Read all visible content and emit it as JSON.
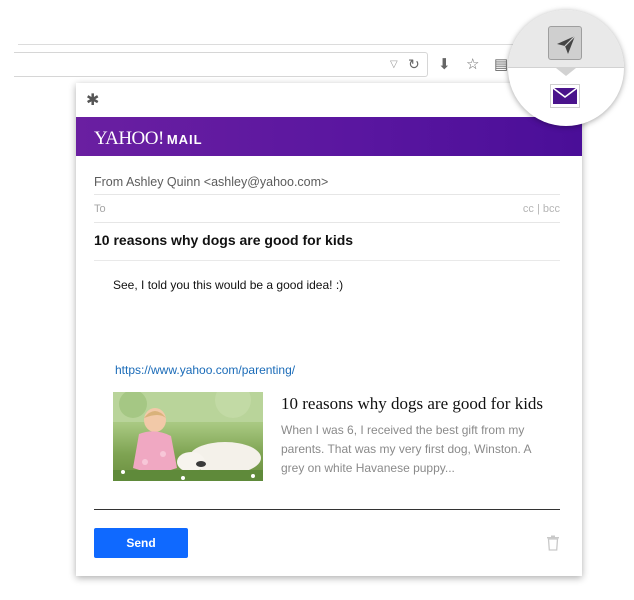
{
  "browser": {
    "toolbar_icons": [
      "download-icon",
      "star-icon",
      "reading-list-icon"
    ]
  },
  "popup": {
    "brand_yahoo": "YAHOO!",
    "brand_mail": "MAIL",
    "from_text": "From Ashley Quinn <ashley@yahoo.com>",
    "to_label": "To",
    "cc_bcc": "cc | bcc",
    "subject": "10 reasons why dogs are good for kids",
    "body": "See, I told you this would be a good idea! :)",
    "link_url": "https://www.yahoo.com/parenting/",
    "card": {
      "title": "10 reasons why dogs are good for kids",
      "description": "When I was 6, I received the best gift from my parents. That was my very first dog, Winston. A grey on white Havanese puppy..."
    },
    "send_label": "Send"
  },
  "colors": {
    "header_purple": "#5a16a0",
    "send_blue": "#0f69ff",
    "link_blue": "#1a6bb8",
    "envelope_purple": "#4a148c"
  }
}
